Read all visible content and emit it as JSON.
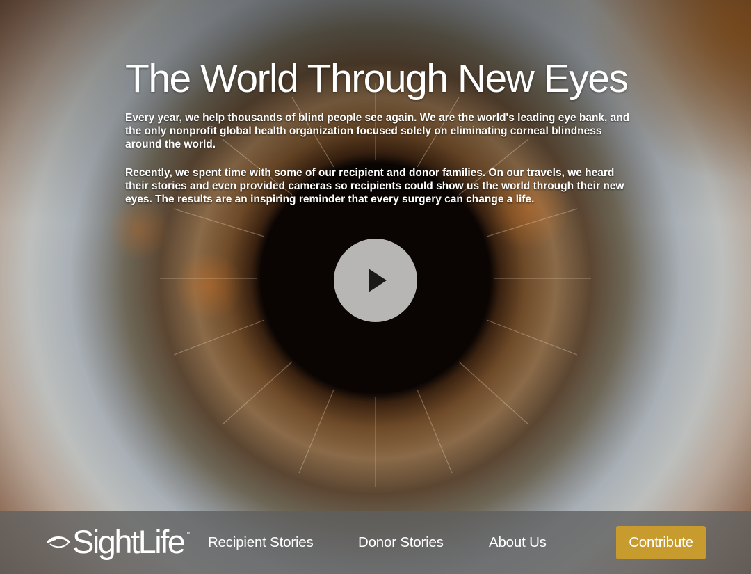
{
  "hero": {
    "title": "The World Through New Eyes",
    "paragraph_1": "Every year, we help thousands of blind people see again. We are the world's leading eye bank, and the only nonprofit global health organization focused solely on eliminating corneal blindness around the world.",
    "paragraph_2": "Recently, we spent time with some of our recipient and donor families. On our travels, we heard their stories and even provided cameras so recipients could show us the world through their new eyes. The results are an inspiring reminder that every surgery can change a life.",
    "play_icon": "play-icon"
  },
  "nav": {
    "logo_text": "SightLife",
    "logo_tm": "™",
    "logo_icon": "eye-icon",
    "links": [
      "Recipient Stories",
      "Donor Stories",
      "About Us"
    ],
    "contribute_label": "Contribute",
    "contribute_color": "#c79b2e"
  }
}
